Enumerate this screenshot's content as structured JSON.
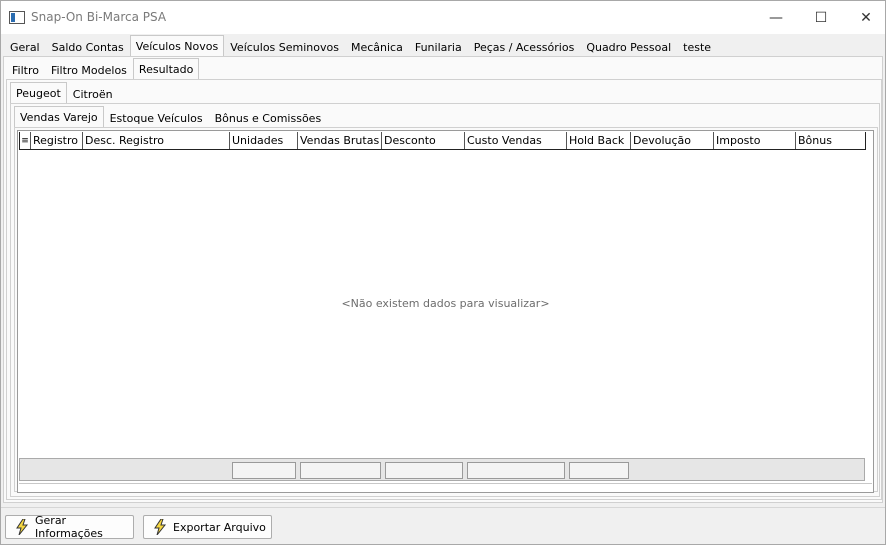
{
  "window": {
    "title": "Snap-On Bi-Marca PSA",
    "minimize": "—",
    "maximize": "☐",
    "close": "✕"
  },
  "main_tabs": [
    "Geral",
    "Saldo Contas",
    "Veículos Novos",
    "Veículos Seminovos",
    "Mecânica",
    "Funilaria",
    "Peças / Acessórios",
    "Quadro Pessoal",
    "teste"
  ],
  "main_tab_active": "Veículos Novos",
  "sub_tabs": [
    "Filtro",
    "Filtro Modelos",
    "Resultado"
  ],
  "sub_tab_active": "Resultado",
  "brand_tabs": [
    "Peugeot",
    "Citroën"
  ],
  "brand_tab_active": "Peugeot",
  "report_tabs": [
    "Vendas Varejo",
    "Estoque Veículos",
    "Bônus e Comissões"
  ],
  "report_tab_active": "Vendas Varejo",
  "grid": {
    "menu_icon": "≡",
    "columns": [
      "Registro",
      "Desc. Registro",
      "Unidades",
      "Vendas Brutas",
      "Desconto",
      "Custo Vendas",
      "Hold Back",
      "Devolução",
      "Imposto",
      "Bônus"
    ],
    "empty_message": "<Não existem dados para visualizar>"
  },
  "buttons": {
    "generate": "Gerar Informações",
    "export": "Exportar Arquivo"
  },
  "icons": {
    "window": "app-window-icon",
    "generate": "lightning-icon",
    "export": "lightning-icon"
  }
}
